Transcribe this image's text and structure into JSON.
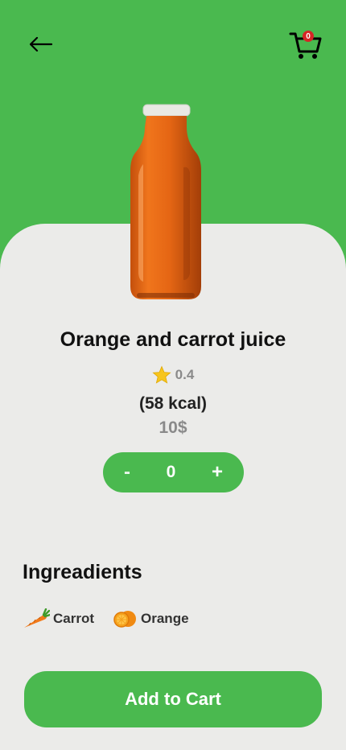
{
  "header": {
    "back_icon": "arrow-left-icon",
    "cart_icon": "shopping-cart-icon",
    "cart_count": "0"
  },
  "product": {
    "name": "Orange and carrot juice",
    "rating": "0.4",
    "calories": "(58 kcal)",
    "price": "10$"
  },
  "quantity": {
    "minus_label": "-",
    "value": "0",
    "plus_label": "+"
  },
  "ingredients": {
    "title": "Ingreadients",
    "items": [
      {
        "label": "Carrot",
        "icon": "carrot-icon"
      },
      {
        "label": "Orange",
        "icon": "orange-icon"
      }
    ]
  },
  "actions": {
    "add_to_cart": "Add to Cart"
  },
  "colors": {
    "primary": "#4ab94f",
    "card_bg": "#ebebe9",
    "badge": "#d62626",
    "star": "#f7c51c"
  }
}
